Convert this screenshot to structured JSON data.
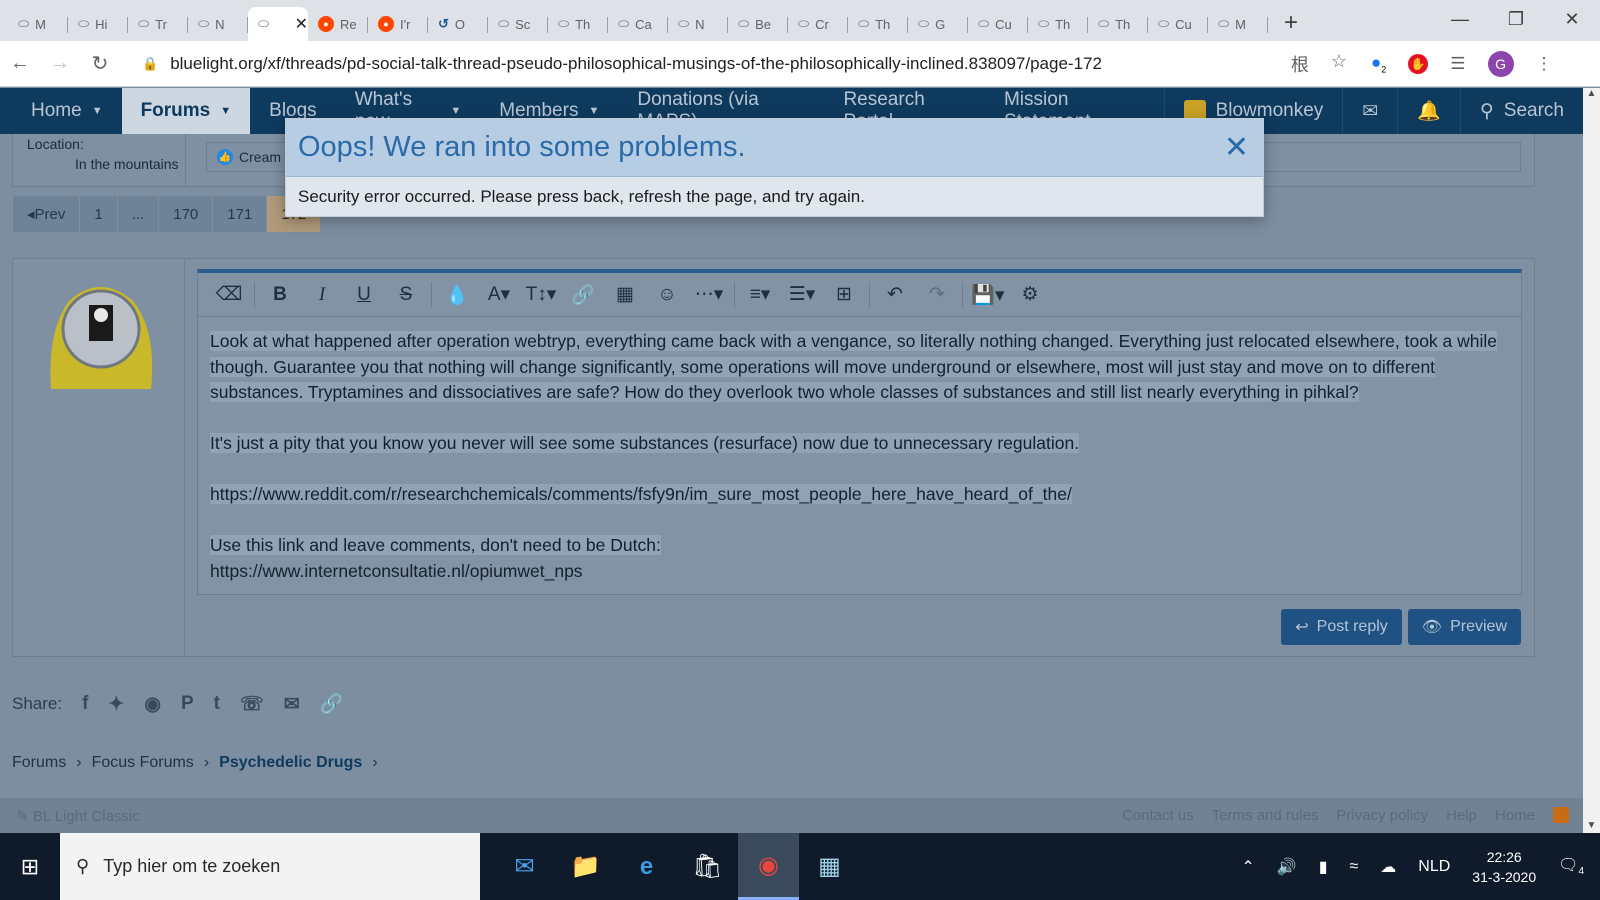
{
  "browser": {
    "tabs": [
      {
        "icon": "pill",
        "label": "M"
      },
      {
        "icon": "pill",
        "label": "Hi"
      },
      {
        "icon": "pill",
        "label": "Tr"
      },
      {
        "icon": "pill",
        "label": "N"
      },
      {
        "icon": "pill",
        "label": ""
      },
      {
        "icon": "reddit",
        "label": "Re"
      },
      {
        "icon": "reddit",
        "label": "I'r"
      },
      {
        "icon": "refresh",
        "label": "O"
      },
      {
        "icon": "pill",
        "label": "Sc"
      },
      {
        "icon": "pill",
        "label": "Th"
      },
      {
        "icon": "pill",
        "label": "Ca"
      },
      {
        "icon": "pill",
        "label": "N"
      },
      {
        "icon": "pill",
        "label": "Be"
      },
      {
        "icon": "pill",
        "label": "Cr"
      },
      {
        "icon": "pill",
        "label": "Th"
      },
      {
        "icon": "pill",
        "label": "G"
      },
      {
        "icon": "pill",
        "label": "Cu"
      },
      {
        "icon": "pill",
        "label": "Th"
      },
      {
        "icon": "pill",
        "label": "Th"
      },
      {
        "icon": "pill",
        "label": "Cu"
      },
      {
        "icon": "pill",
        "label": "M"
      }
    ],
    "active_tab_index": 4,
    "url": "bluelight.org/xf/threads/pd-social-talk-thread-pseudo-philosophical-musings-of-the-philosophically-inclined.838097/page-172",
    "profile_initial": "G",
    "extension_badge": "2"
  },
  "site_nav": {
    "items": [
      {
        "label": "Home",
        "caret": true
      },
      {
        "label": "Forums",
        "caret": true
      },
      {
        "label": "Blogs",
        "caret": false
      },
      {
        "label": "What's new",
        "caret": true
      },
      {
        "label": "Members",
        "caret": true
      },
      {
        "label": "Donations (via MAPS)",
        "caret": false
      },
      {
        "label": "Research Portal",
        "caret": false
      },
      {
        "label": "Mission Statement",
        "caret": false
      }
    ],
    "user": "Blowmonkey",
    "search": "Search"
  },
  "prev_post": {
    "location_label": "Location:",
    "location_value": "In the mountains",
    "reaction_text": "Cream C"
  },
  "pager": {
    "prev": "Prev",
    "pages": [
      "1",
      "...",
      "170",
      "171",
      "172"
    ],
    "current": "172"
  },
  "editor": {
    "paragraphs": [
      "Look at what happened after operation webtryp, everything came back with a vengance, so literally nothing changed. Everything just relocated elsewhere, took a while though. Guarantee you that nothing will change significantly, some operations will move underground or elsewhere, most will just stay and move on to different substances. Tryptamines and dissociatives are safe? How do they overlook two whole classes of substances and still list nearly everything in pihkal?",
      "It's just a pity that you know you never will see some substances (resurface) now due to unnecessary regulation.",
      "https://www.reddit.com/r/researchchemicals/comments/fsfy9n/im_sure_most_people_here_have_heard_of_the/",
      "Use this link and leave comments, don't need to be Dutch:",
      "https://www.internetconsultatie.nl/opiumwet_nps"
    ]
  },
  "buttons": {
    "post_reply": "Post reply",
    "preview": "Preview"
  },
  "share": {
    "label": "Share:"
  },
  "breadcrumb": {
    "items": [
      "Forums",
      "Focus Forums",
      "Psychedelic Drugs"
    ]
  },
  "footer": {
    "style": "BL Light Classic",
    "links": [
      "Contact us",
      "Terms and rules",
      "Privacy policy",
      "Help",
      "Home"
    ]
  },
  "modal": {
    "title": "Oops! We ran into some problems.",
    "message": "Security error occurred. Please press back, refresh the page, and try again."
  },
  "taskbar": {
    "search_placeholder": "Typ hier om te zoeken",
    "language": "NLD",
    "time": "22:26",
    "date": "31-3-2020",
    "notification_count": "4"
  }
}
